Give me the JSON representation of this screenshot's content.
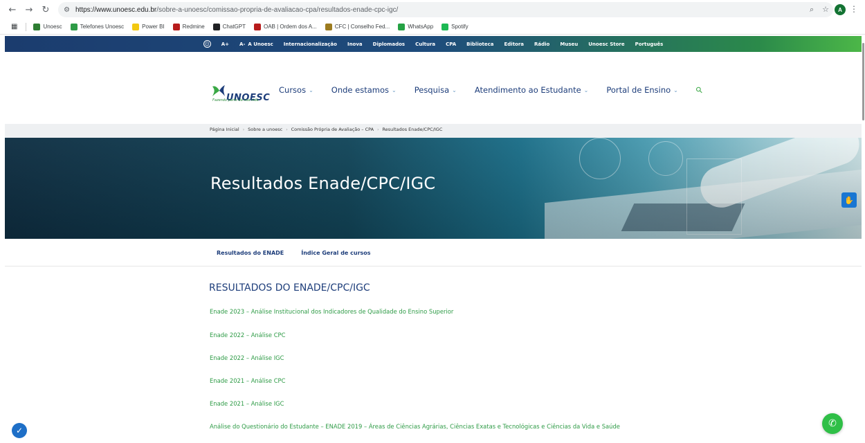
{
  "browser": {
    "url_host": "https://www.unoesc.edu.br",
    "url_path": "/sobre-a-unoesc/comissao-propria-de-avaliacao-cpa/resultados-enade-cpc-igc/",
    "profile_initial": "A",
    "bookmarks": [
      {
        "label": "Unoesc",
        "color": "#2e7d32"
      },
      {
        "label": "Telefones Unoesc",
        "color": "#2e9b46"
      },
      {
        "label": "Power BI",
        "color": "#f2c811"
      },
      {
        "label": "Redmine",
        "color": "#b71c1c"
      },
      {
        "label": "ChatGPT",
        "color": "#202124"
      },
      {
        "label": "OAB | Ordem dos A...",
        "color": "#b71c1c"
      },
      {
        "label": "CFC | Conselho Fed...",
        "color": "#9c7b1f"
      },
      {
        "label": "WhatsApp",
        "color": "#25a244"
      },
      {
        "label": "Spotify",
        "color": "#1db954"
      }
    ]
  },
  "topbar": {
    "font_plus": "A+",
    "font_minus": "A-",
    "links": [
      "A Unoesc",
      "Internacionalização",
      "Inova",
      "Diplomados",
      "Cultura",
      "CPA",
      "Biblioteca",
      "Editora",
      "Rádio",
      "Museu",
      "Unoesc Store",
      "Português"
    ]
  },
  "header": {
    "logo_text": "UNOESC",
    "logo_tagline": "Fazendo parte da sua vida",
    "nav": [
      "Cursos",
      "Onde estamos",
      "Pesquisa",
      "Atendimento ao Estudante",
      "Portal de Ensino"
    ]
  },
  "breadcrumb": [
    "Página Inicial",
    "Sobre a unoesc",
    "Comissão Própria de Avaliação – CPA",
    "Resultados Enade/CPC/IGC"
  ],
  "hero": {
    "title": "Resultados Enade/CPC/IGC"
  },
  "subnav": [
    "Resultados do ENADE",
    "Índice Geral de cursos"
  ],
  "content": {
    "heading": "RESULTADOS DO ENADE/CPC/IGC",
    "links": [
      "Enade 2023 – Análise Institucional dos Indicadores de Qualidade do Ensino Superior",
      "Enade 2022 – Análise CPC",
      "Enade 2022 – Análise IGC",
      "Enade 2021 – Análise CPC",
      "Enade 2021 – Análise IGC",
      "Análise do Questionário do Estudante – ENADE 2019 – Áreas de Ciências Agrárias, Ciências Exatas e Tecnológicas e Ciências da Vida e Saúde"
    ]
  }
}
